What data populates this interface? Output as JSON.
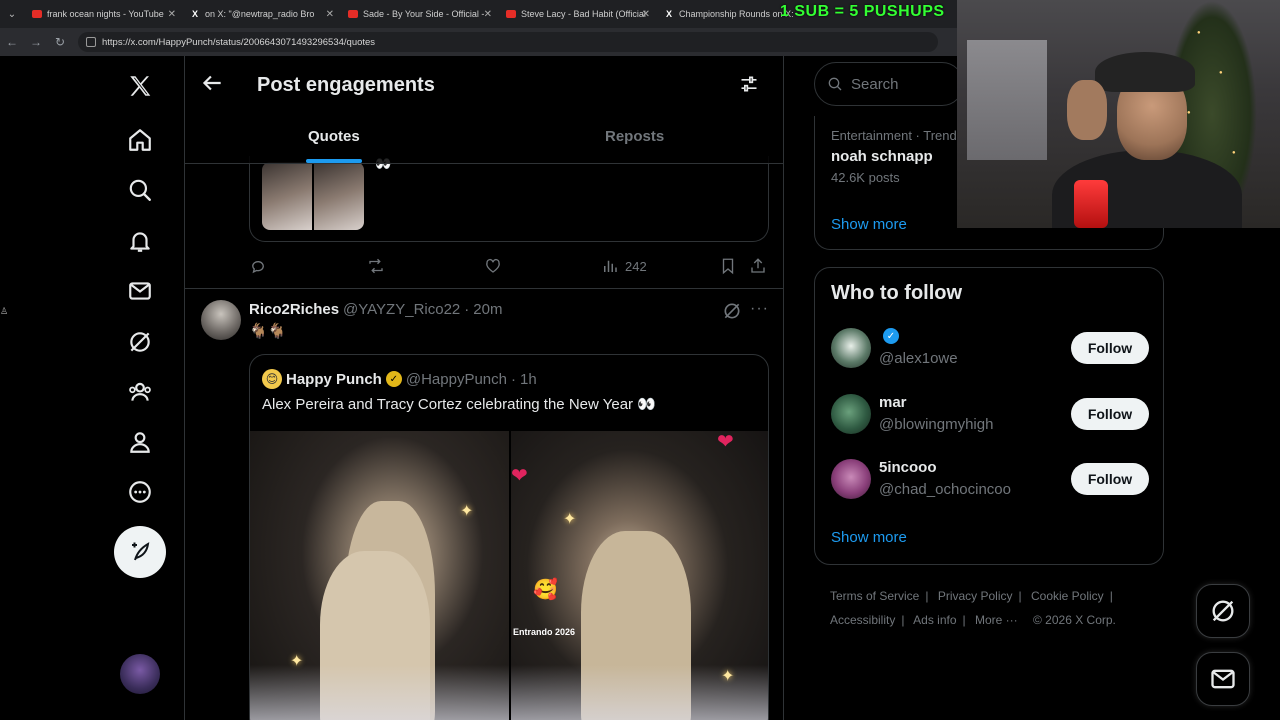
{
  "browser": {
    "tabs": [
      {
        "icon": "youtube-icon",
        "title": "frank ocean nights - YouTube"
      },
      {
        "icon": "x-icon",
        "title": "on X: \"@newtrap_radio Bro"
      },
      {
        "icon": "youtube-icon",
        "title": "Sade - By Your Side - Official -"
      },
      {
        "icon": "youtube-icon",
        "title": "Steve Lacy - Bad Habit (Official"
      },
      {
        "icon": "x-icon",
        "title": "Championship Rounds on X:"
      }
    ],
    "url": "https://x.com/HappyPunch/status/2006643071493296534/quotes"
  },
  "stream_overlay": {
    "text": "1 SUB = 5 PUSHUPS"
  },
  "header": {
    "title": "Post engagements",
    "tabs": [
      {
        "label": "Quotes",
        "active": true
      },
      {
        "label": "Reposts",
        "active": false
      }
    ]
  },
  "previous_post": {
    "views": "242",
    "eyes": "👀"
  },
  "post": {
    "author_name": "Rico2Riches",
    "handle": "@YAYZY_Rico22",
    "separator": "·",
    "time": "20m",
    "text": "🐐🐐",
    "quoted": {
      "avatar_emoji": "😊",
      "author_name": "Happy Punch",
      "handle": "@HappyPunch",
      "time": "1h",
      "text": "Alex Pereira and Tracy Cortez celebrating the New Year 👀",
      "photo_caption": "Entrando 2026"
    }
  },
  "sidebar": {
    "search_placeholder": "Search",
    "trend": {
      "category": "Entertainment · Trending",
      "title": "noah schnapp",
      "count": "42.6K posts"
    },
    "show_more": "Show more",
    "who_to_follow": {
      "title": "Who to follow",
      "follow_label": "Follow",
      "users": [
        {
          "name": "",
          "handle": "@alex1owe",
          "verified": true,
          "avatar_color": "#4a6a58"
        },
        {
          "name": "mar",
          "handle": "@blowingmyhigh",
          "verified": false,
          "avatar_color": "#2f5a42"
        },
        {
          "name": "5incooo",
          "handle": "@chad_ochocincoo",
          "verified": false,
          "avatar_color": "#8a3f7a"
        }
      ]
    },
    "footer": {
      "links": [
        "Terms of Service",
        "Privacy Policy",
        "Cookie Policy",
        "Accessibility",
        "Ads info",
        "More ···"
      ],
      "copyright": "© 2026 X Corp."
    }
  },
  "colors": {
    "accent": "#1d9bf0",
    "background": "#000000",
    "text_primary": "#e7e9ea",
    "text_secondary": "#71767b",
    "border": "#2f3336",
    "overlay_green": "#33ff33"
  }
}
